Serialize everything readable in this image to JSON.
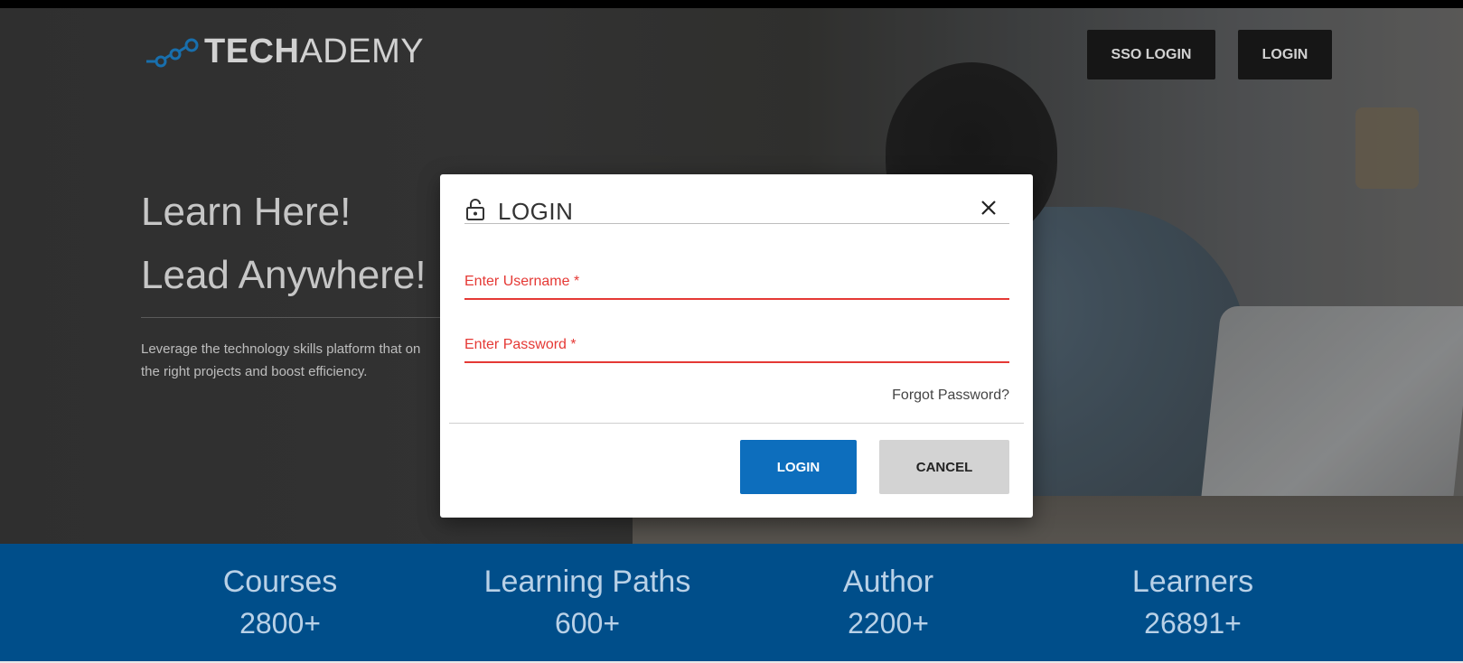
{
  "header": {
    "logo": {
      "bold_text": "TECH",
      "light_text": "ADEMY",
      "mark_icon": "network-nodes-logo-icon",
      "mark_color": "#1e88d4"
    },
    "sso_login_label": "SSO LOGIN",
    "login_label": "LOGIN"
  },
  "hero": {
    "headline_1": "Learn Here!",
    "headline_2": "Lead Anywhere!",
    "description": "Leverage the technology skills platform that on the right projects and boost efficiency."
  },
  "login_modal": {
    "lock_icon": "lock-icon",
    "title": "LOGIN",
    "close_icon": "close-icon",
    "username_label": "Enter Username *",
    "password_label": "Enter Password *",
    "forgot_password": "Forgot Password?",
    "login_button": "LOGIN",
    "cancel_button": "CANCEL",
    "colors": {
      "error": "#e53935",
      "primary": "#0d6ebd",
      "secondary": "#d3d3d3"
    }
  },
  "stats": {
    "items": [
      {
        "label": "Courses",
        "value": "2800+"
      },
      {
        "label": "Learning Paths",
        "value": "600+"
      },
      {
        "label": "Author",
        "value": "2200+"
      },
      {
        "label": "Learners",
        "value": "26891+"
      }
    ],
    "background": "#004e8a"
  }
}
